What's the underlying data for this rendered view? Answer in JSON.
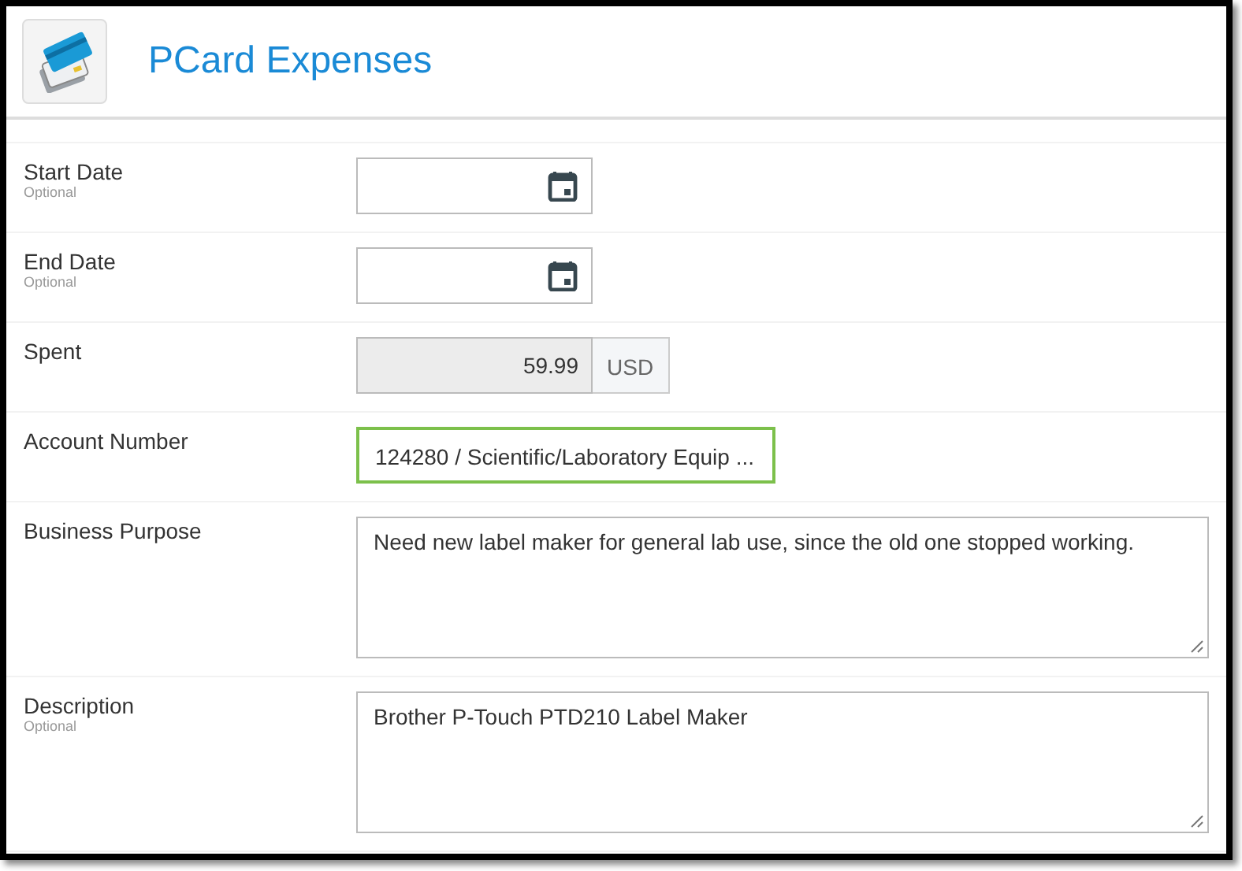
{
  "header": {
    "title": "PCard Expenses"
  },
  "fields": [
    {
      "kind": "date",
      "label": "Start Date",
      "hint": "Optional"
    },
    {
      "kind": "date",
      "label": "End Date",
      "hint": "Optional"
    },
    {
      "kind": "currency",
      "label": "Spent",
      "value": "59.99",
      "unit": "USD"
    },
    {
      "kind": "select",
      "label": "Account Number",
      "value": "124280 / Scientific/Laboratory Equip ..."
    },
    {
      "kind": "textarea",
      "label": "Business Purpose",
      "value": "Need new label maker for general lab use, since the old one stopped working."
    },
    {
      "kind": "textarea",
      "label": "Description",
      "hint": "Optional",
      "value": "Brother P-Touch PTD210 Label Maker"
    }
  ]
}
